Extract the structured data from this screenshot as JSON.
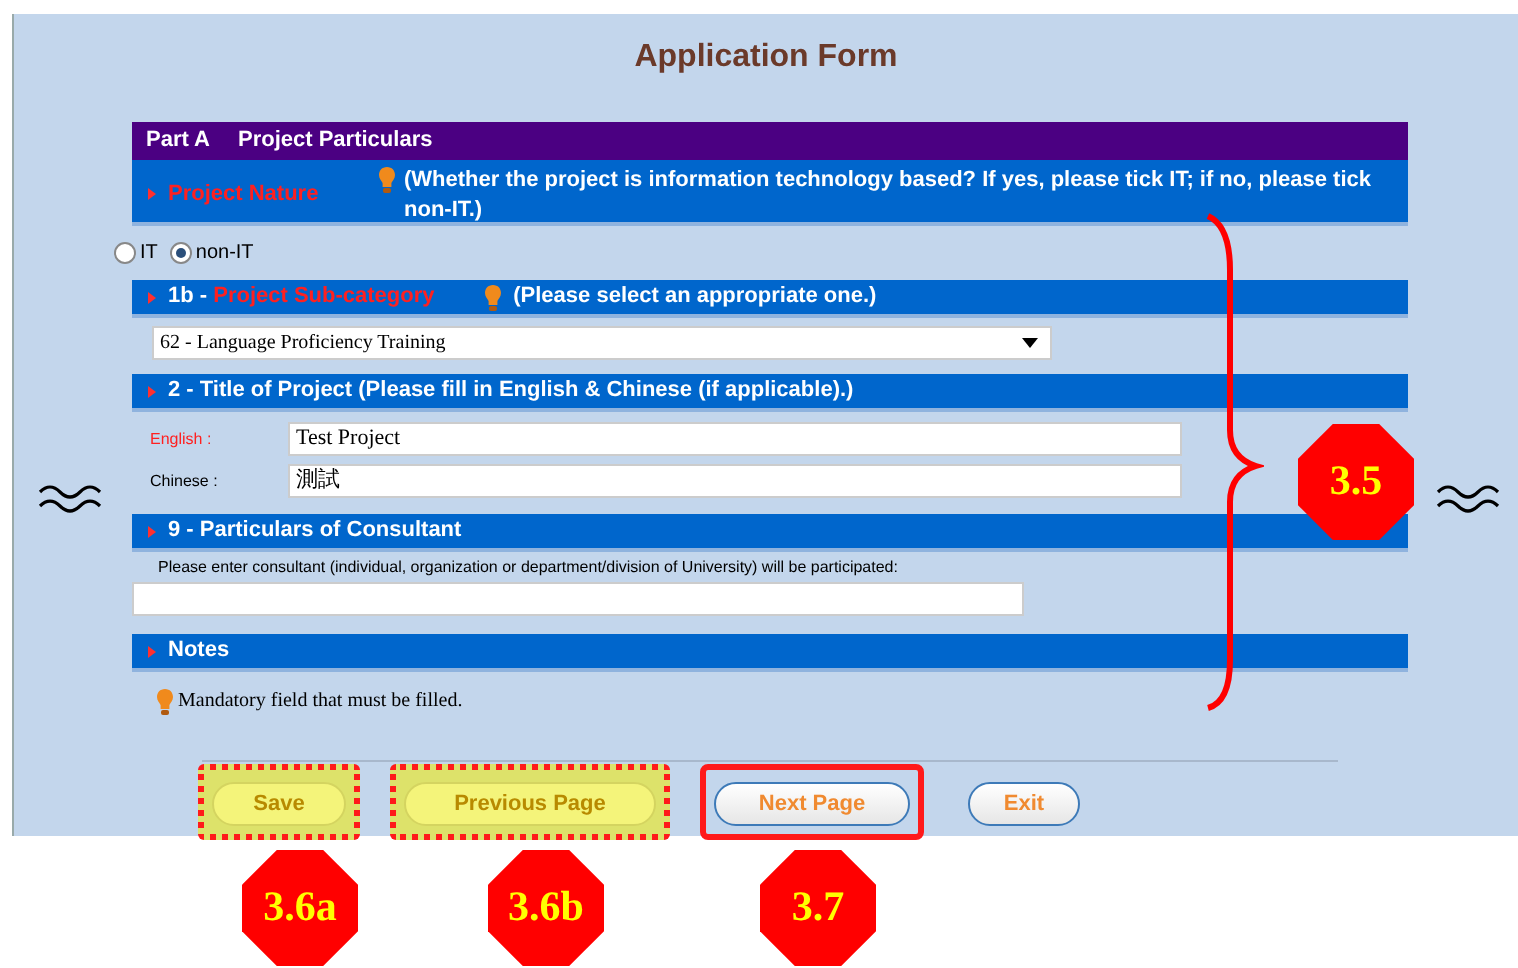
{
  "title": "Application Form",
  "part_header": {
    "part": "Part A",
    "title": "Project Particulars"
  },
  "project_nature": {
    "label": "Project Nature",
    "hint": "(Whether the project is information technology based? If yes, please tick IT; if no, please tick non-IT.)",
    "mandatory": true
  },
  "nature_options": [
    {
      "label": "IT",
      "selected": false
    },
    {
      "label": "non-IT",
      "selected": true
    }
  ],
  "subcategory": {
    "prefix": "1b - ",
    "label": "Project Sub-category",
    "hint": "(Please select an appropriate one.)",
    "mandatory": true,
    "value": "62 - Language Proficiency Training"
  },
  "title_section": {
    "heading": "2 - Title of Project (Please fill in English & Chinese (if applicable).)"
  },
  "title_fields": [
    {
      "label": "English :",
      "required": true,
      "value": "Test Project"
    },
    {
      "label": "Chinese :",
      "required": false,
      "value": "測試"
    }
  ],
  "consultant": {
    "heading": "9 - Particulars of Consultant",
    "instruction": "Please enter consultant (individual, organization or department/division of University) will be participated:"
  },
  "notes": {
    "heading": "Notes",
    "text": "Mandatory field that must be filled."
  },
  "buttons": [
    {
      "label": "Save",
      "disabled": true,
      "dotted_frame": true,
      "solid_frame": false
    },
    {
      "label": "Previous Page",
      "disabled": true,
      "dotted_frame": true,
      "solid_frame": false
    },
    {
      "label": "Next Page",
      "disabled": false,
      "dotted_frame": false,
      "solid_frame": true
    },
    {
      "label": "Exit",
      "disabled": false,
      "dotted_frame": false,
      "solid_frame": false
    }
  ],
  "callouts": [
    {
      "label": "3.5"
    },
    {
      "label": "3.6a"
    },
    {
      "label": "3.6b"
    },
    {
      "label": "3.7"
    }
  ]
}
